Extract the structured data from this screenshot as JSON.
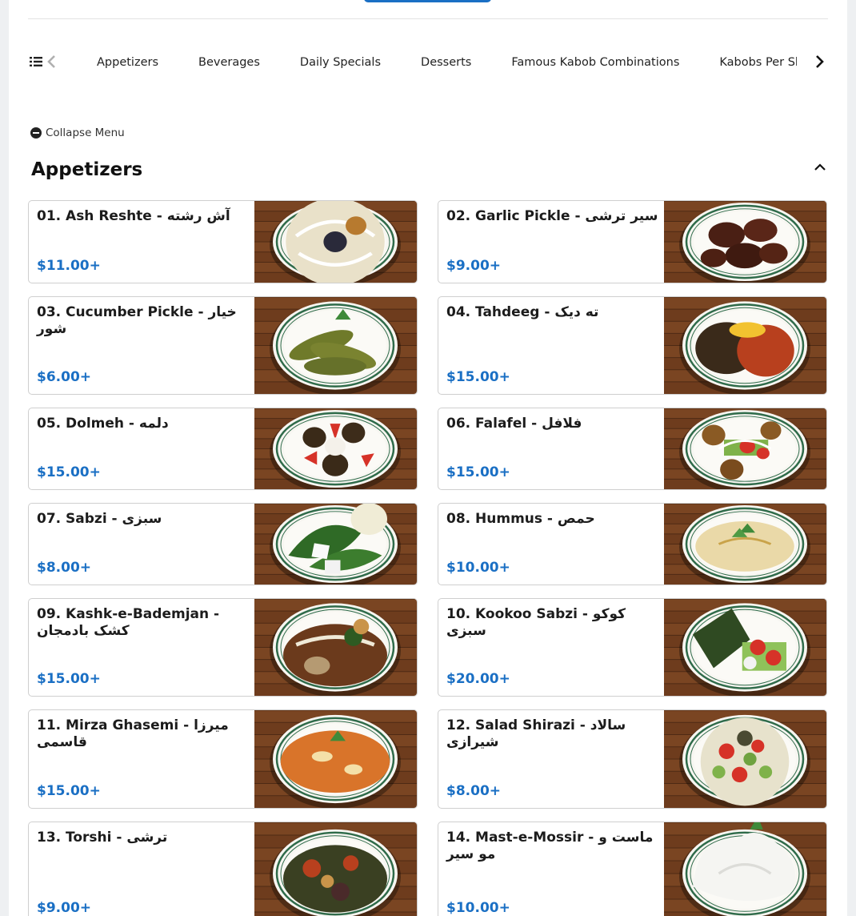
{
  "nav": {
    "categories": [
      "Appetizers",
      "Beverages",
      "Daily Specials",
      "Desserts",
      "Famous Kabob Combinations",
      "Kabobs Per Sk"
    ]
  },
  "menu": {
    "collapse_label": "Collapse Menu",
    "section_title": "Appetizers"
  },
  "items": [
    {
      "name": "01. Ash Reshte - آش رشته",
      "price": "$11.00+",
      "image": "soup-plate"
    },
    {
      "name": "02. Garlic Pickle - سیر ترشی",
      "price": "$9.00+",
      "image": "pickled-garlic-plate"
    },
    {
      "name": "03. Cucumber Pickle - خیار شور",
      "price": "$6.00+",
      "image": "pickle-plate"
    },
    {
      "name": "04. Tahdeeg - ته دیک",
      "price": "$15.00+",
      "image": "tahdeeg-plate"
    },
    {
      "name": "05. Dolmeh - دلمه",
      "price": "$15.00+",
      "image": "dolmeh-plate"
    },
    {
      "name": "06. Falafel - فلافل",
      "price": "$15.00+",
      "image": "falafel-plate"
    },
    {
      "name": "07. Sabzi - سبزی",
      "price": "$8.00+",
      "image": "herbs-plate"
    },
    {
      "name": "08. Hummus - حمص",
      "price": "$10.00+",
      "image": "hummus-plate"
    },
    {
      "name": "09. Kashk-e-Bademjan - کشک بادمجان",
      "price": "$15.00+",
      "image": "kashk-plate"
    },
    {
      "name": "10. Kookoo Sabzi - کوکو سبزی",
      "price": "$20.00+",
      "image": "kookoo-plate"
    },
    {
      "name": "11. Mirza Ghasemi - میرزا قاسمی",
      "price": "$15.00+",
      "image": "mirza-plate"
    },
    {
      "name": "12. Salad Shirazi - سالاد شیرازی",
      "price": "$8.00+",
      "image": "salad-plate"
    },
    {
      "name": "13. Torshi - ترشی",
      "price": "$9.00+",
      "image": "torshi-plate"
    },
    {
      "name": "14. Mast-e-Mossir - ماست و مو سیر",
      "price": "$10.00+",
      "image": "yogurt-plate"
    }
  ],
  "colors": {
    "accent": "#1a6fc4",
    "wood": "#7a4522",
    "plate_rim": "#2f6b4a"
  }
}
